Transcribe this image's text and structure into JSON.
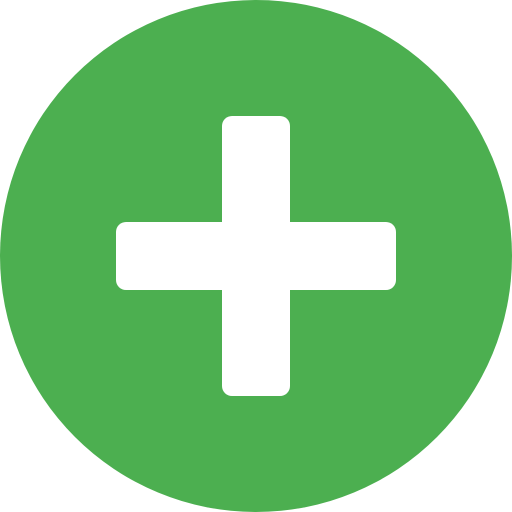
{
  "icon": {
    "name": "plus-circle-icon",
    "background_color": "#4caf50",
    "foreground_color": "#ffffff"
  }
}
